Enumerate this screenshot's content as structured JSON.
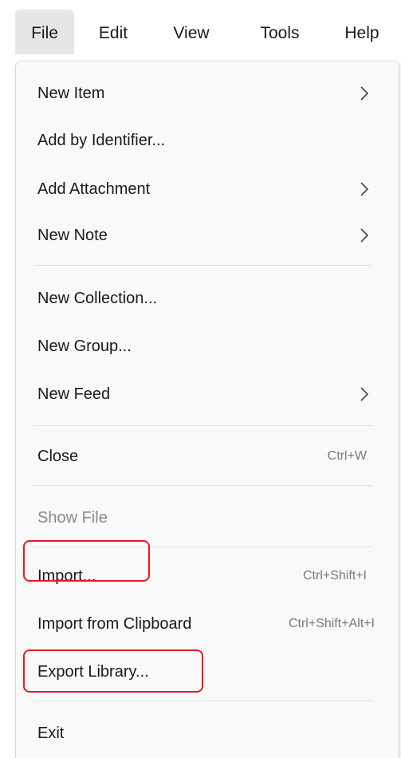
{
  "menubar": {
    "items": [
      {
        "label": "File"
      },
      {
        "label": "Edit"
      },
      {
        "label": "View"
      },
      {
        "label": "Tools"
      },
      {
        "label": "Help"
      }
    ]
  },
  "file_menu": {
    "items": [
      {
        "label": "New Item",
        "submenu": true
      },
      {
        "label": "Add by Identifier..."
      },
      {
        "label": "Add Attachment",
        "submenu": true
      },
      {
        "label": "New Note",
        "submenu": true
      },
      {
        "label": "New Collection..."
      },
      {
        "label": "New Group..."
      },
      {
        "label": "New Feed",
        "submenu": true
      },
      {
        "label": "Close",
        "shortcut": "Ctrl+W"
      },
      {
        "label": "Show File",
        "disabled": true
      },
      {
        "label": "Import...",
        "shortcut": "Ctrl+Shift+I",
        "highlighted": true
      },
      {
        "label": "Import from Clipboard",
        "shortcut": "Ctrl+Shift+Alt+I"
      },
      {
        "label": "Export Library...",
        "highlighted": true
      },
      {
        "label": "Exit"
      }
    ]
  },
  "icons": {
    "submenu_arrow": "chevron-right-icon"
  },
  "colors": {
    "highlight_box": "#e31b23",
    "menu_background": "#f9f9f9",
    "active_menubar_item": "#e6e6e6",
    "disabled_text": "#8a8a8a"
  }
}
